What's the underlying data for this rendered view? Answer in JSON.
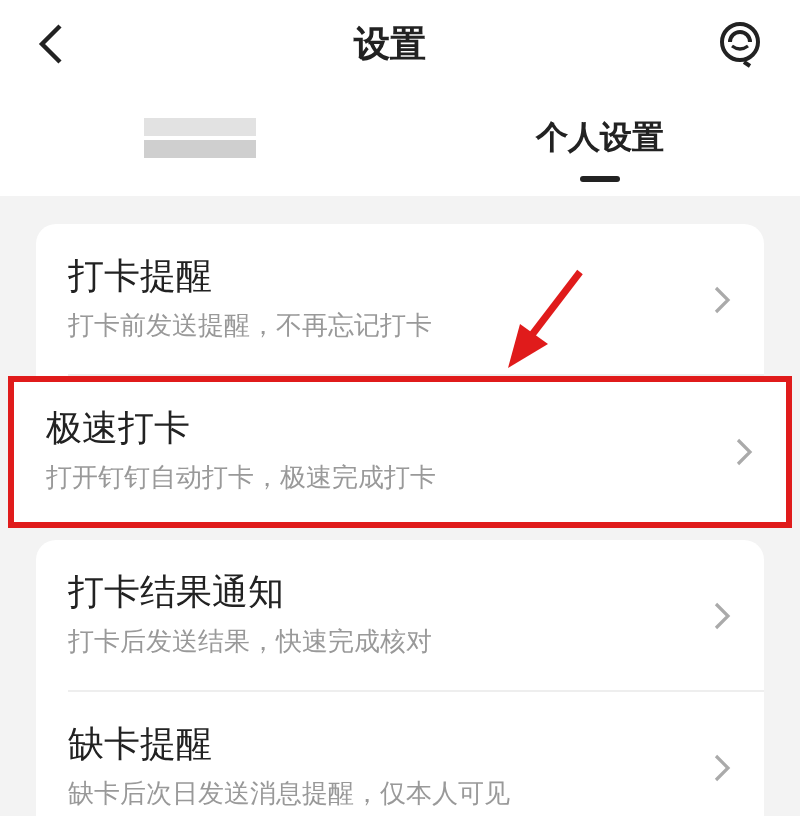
{
  "header": {
    "title": "设置"
  },
  "tabs": [
    {
      "kind": "pixelated",
      "selected": false
    },
    {
      "kind": "text",
      "label": "个人设置",
      "selected": true
    }
  ],
  "groups": [
    [
      {
        "title": "打卡提醒",
        "subtitle": "打卡前发送提醒，不再忘记打卡",
        "highlighted": false
      },
      {
        "title": "极速打卡",
        "subtitle": "打开钉钉自动打卡，极速完成打卡",
        "highlighted": true
      }
    ],
    [
      {
        "title": "打卡结果通知",
        "subtitle": "打卡后发送结果，快速完成核对",
        "highlighted": false
      },
      {
        "title": "缺卡提醒",
        "subtitle": "缺卡后次日发送消息提醒，仅本人可见",
        "highlighted": false
      }
    ]
  ]
}
